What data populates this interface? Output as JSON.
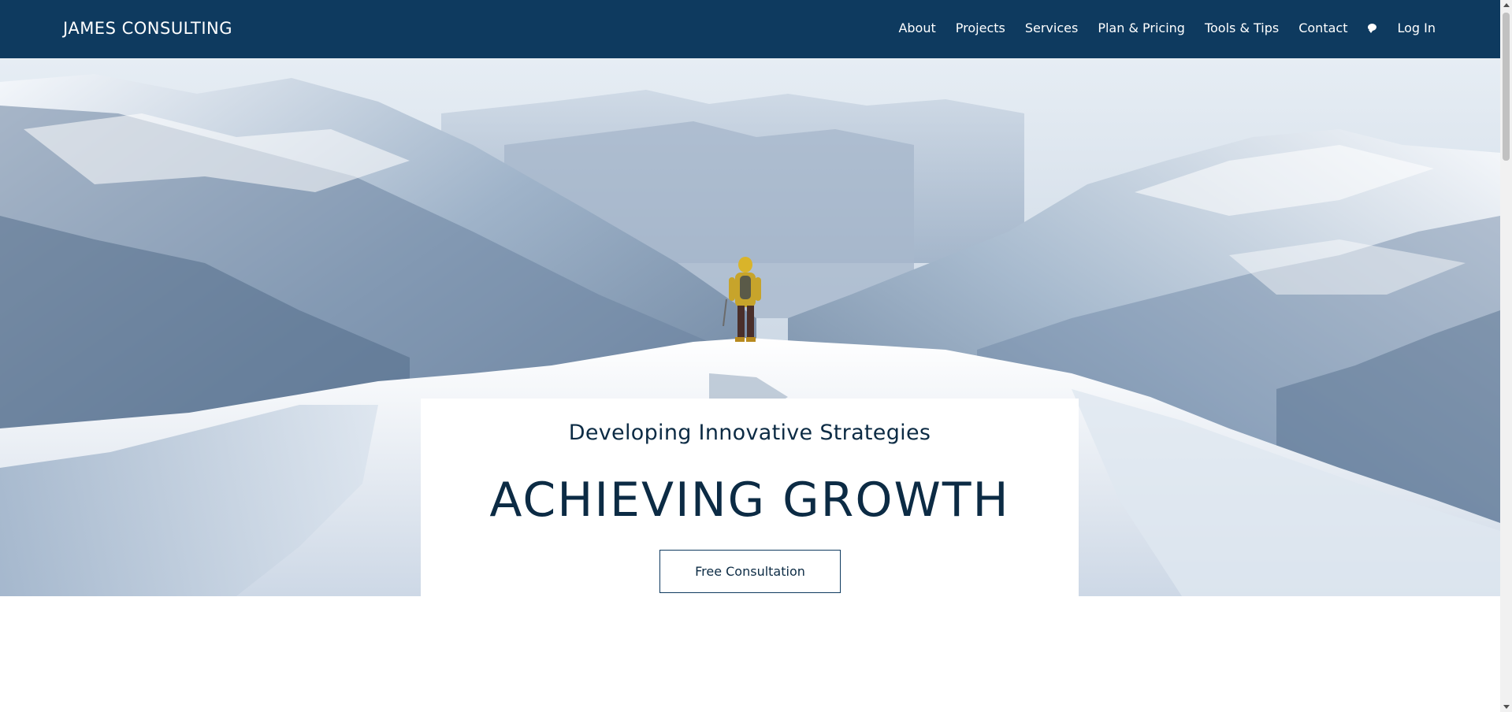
{
  "header": {
    "brand": "JAMES CONSULTING",
    "nav": [
      "About",
      "Projects",
      "Services",
      "Plan & Pricing",
      "Tools & Tips",
      "Contact"
    ],
    "chat_icon": "chat-bubble-icon",
    "login": "Log In",
    "background_color": "#0e3a5f"
  },
  "hero": {
    "subtitle": "Developing Innovative Strategies",
    "headline": "ACHIEVING GROWTH",
    "cta_label": "Free Consultation",
    "text_color": "#0c2b44"
  }
}
